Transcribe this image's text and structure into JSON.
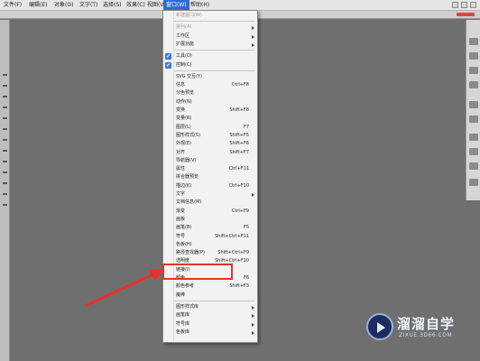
{
  "menubar": {
    "items": [
      "文件(F)",
      "编辑(E)",
      "对象(O)",
      "文字(T)",
      "选择(S)",
      "效果(C)",
      "视图(V)",
      "窗口(W)",
      "帮助(H)"
    ],
    "active_index": 7
  },
  "window_menu": {
    "items": [
      {
        "label": "新建窗口(W)",
        "shortcut": "",
        "disabled": true,
        "submenu": false,
        "checked": false
      },
      {
        "label": "排列(A)",
        "shortcut": "",
        "disabled": true,
        "submenu": true,
        "checked": false
      },
      {
        "label": "工作区",
        "shortcut": "",
        "disabled": false,
        "submenu": true,
        "checked": false
      },
      {
        "label": "扩展功能",
        "shortcut": "",
        "disabled": false,
        "submenu": true,
        "checked": false
      },
      {
        "label": "工具(O)",
        "shortcut": "",
        "disabled": false,
        "submenu": false,
        "checked": true
      },
      {
        "label": "控制(C)",
        "shortcut": "",
        "disabled": false,
        "submenu": false,
        "checked": true
      },
      {
        "label": "SVG 交互(Y)",
        "shortcut": "",
        "disabled": false,
        "submenu": false,
        "checked": false
      },
      {
        "label": "信息",
        "shortcut": "Ctrl+F8",
        "disabled": false,
        "submenu": false,
        "checked": false
      },
      {
        "label": "分色预览",
        "shortcut": "",
        "disabled": false,
        "submenu": false,
        "checked": false
      },
      {
        "label": "动作(N)",
        "shortcut": "",
        "disabled": false,
        "submenu": false,
        "checked": false
      },
      {
        "label": "变换",
        "shortcut": "Shift+F8",
        "disabled": false,
        "submenu": false,
        "checked": false
      },
      {
        "label": "变量(R)",
        "shortcut": "",
        "disabled": false,
        "submenu": false,
        "checked": false
      },
      {
        "label": "图层(L)",
        "shortcut": "F7",
        "disabled": false,
        "submenu": false,
        "checked": false
      },
      {
        "label": "图形样式(S)",
        "shortcut": "Shift+F5",
        "disabled": false,
        "submenu": false,
        "checked": false
      },
      {
        "label": "外观(E)",
        "shortcut": "Shift+F6",
        "disabled": false,
        "submenu": false,
        "checked": false
      },
      {
        "label": "对齐",
        "shortcut": "Shift+F7",
        "disabled": false,
        "submenu": false,
        "checked": false
      },
      {
        "label": "导航器(V)",
        "shortcut": "",
        "disabled": false,
        "submenu": false,
        "checked": false
      },
      {
        "label": "属性",
        "shortcut": "Ctrl+F11",
        "disabled": false,
        "submenu": false,
        "checked": false
      },
      {
        "label": "拼合器预览",
        "shortcut": "",
        "disabled": false,
        "submenu": false,
        "checked": false
      },
      {
        "label": "描边(K)",
        "shortcut": "Ctrl+F10",
        "disabled": false,
        "submenu": false,
        "checked": false
      },
      {
        "label": "文字",
        "shortcut": "",
        "disabled": false,
        "submenu": true,
        "checked": false
      },
      {
        "label": "文档信息(M)",
        "shortcut": "",
        "disabled": false,
        "submenu": false,
        "checked": false
      },
      {
        "label": "渐变",
        "shortcut": "Ctrl+F9",
        "disabled": false,
        "submenu": false,
        "checked": false
      },
      {
        "label": "画板",
        "shortcut": "",
        "disabled": false,
        "submenu": false,
        "checked": false
      },
      {
        "label": "画笔(B)",
        "shortcut": "F5",
        "disabled": false,
        "submenu": false,
        "checked": false
      },
      {
        "label": "符号",
        "shortcut": "Shift+Ctrl+F11",
        "disabled": false,
        "submenu": false,
        "checked": false
      },
      {
        "label": "色板(H)",
        "shortcut": "",
        "disabled": false,
        "submenu": false,
        "checked": false
      },
      {
        "label": "路径查找器(P)",
        "shortcut": "Shift+Ctrl+F9",
        "disabled": false,
        "submenu": false,
        "checked": false
      },
      {
        "label": "透明度",
        "shortcut": "Shift+Ctrl+F10",
        "disabled": false,
        "submenu": false,
        "checked": false
      },
      {
        "label": "链接(I)",
        "shortcut": "",
        "disabled": false,
        "submenu": false,
        "checked": false
      },
      {
        "label": "颜色",
        "shortcut": "F6",
        "disabled": false,
        "submenu": false,
        "checked": false
      },
      {
        "label": "颜色参考",
        "shortcut": "Shift+F3",
        "disabled": false,
        "submenu": false,
        "checked": false
      },
      {
        "label": "魔棒",
        "shortcut": "",
        "disabled": false,
        "submenu": false,
        "checked": false
      },
      {
        "label": "图形样式库",
        "shortcut": "",
        "disabled": false,
        "submenu": true,
        "checked": false
      },
      {
        "label": "画笔库",
        "shortcut": "",
        "disabled": false,
        "submenu": true,
        "checked": false
      },
      {
        "label": "符号库",
        "shortcut": "",
        "disabled": false,
        "submenu": true,
        "checked": false
      },
      {
        "label": "色板库",
        "shortcut": "",
        "disabled": false,
        "submenu": true,
        "checked": false
      }
    ]
  },
  "watermark": {
    "title": "溜溜自学",
    "subtitle": "ZIXUE.3D66.COM"
  },
  "colors": {
    "highlight": "#e8322a",
    "menu_active": "#2e6ad4",
    "workspace": "#6f6f6f"
  },
  "icons": [
    "checkmark-icon",
    "submenu-arrow-icon",
    "watermark-logo-icon"
  ]
}
